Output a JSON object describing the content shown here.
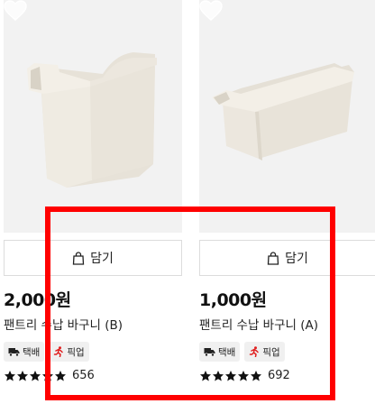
{
  "products": [
    {
      "image_icon": "storage-basket-tall-image",
      "cart_label": "담기",
      "price": "2,000원",
      "name": "팬트리 수납 바구니 (B)",
      "badges": [
        {
          "icon": "delivery-truck-icon",
          "label": "택배"
        },
        {
          "icon": "pickup-runner-icon",
          "label": "픽업"
        }
      ],
      "rating_stars": 4.5,
      "review_count": "656"
    },
    {
      "image_icon": "storage-basket-long-image",
      "cart_label": "담기",
      "price": "1,000원",
      "name": "팬트리 수납 바구니 (A)",
      "badges": [
        {
          "icon": "delivery-truck-icon",
          "label": "택배"
        },
        {
          "icon": "pickup-runner-icon",
          "label": "픽업"
        }
      ],
      "rating_stars": 4.5,
      "review_count": "692"
    }
  ],
  "colors": {
    "image_bg": "#f2f2f2",
    "highlight": "#ff0000",
    "pickup_icon": "#e02020"
  }
}
